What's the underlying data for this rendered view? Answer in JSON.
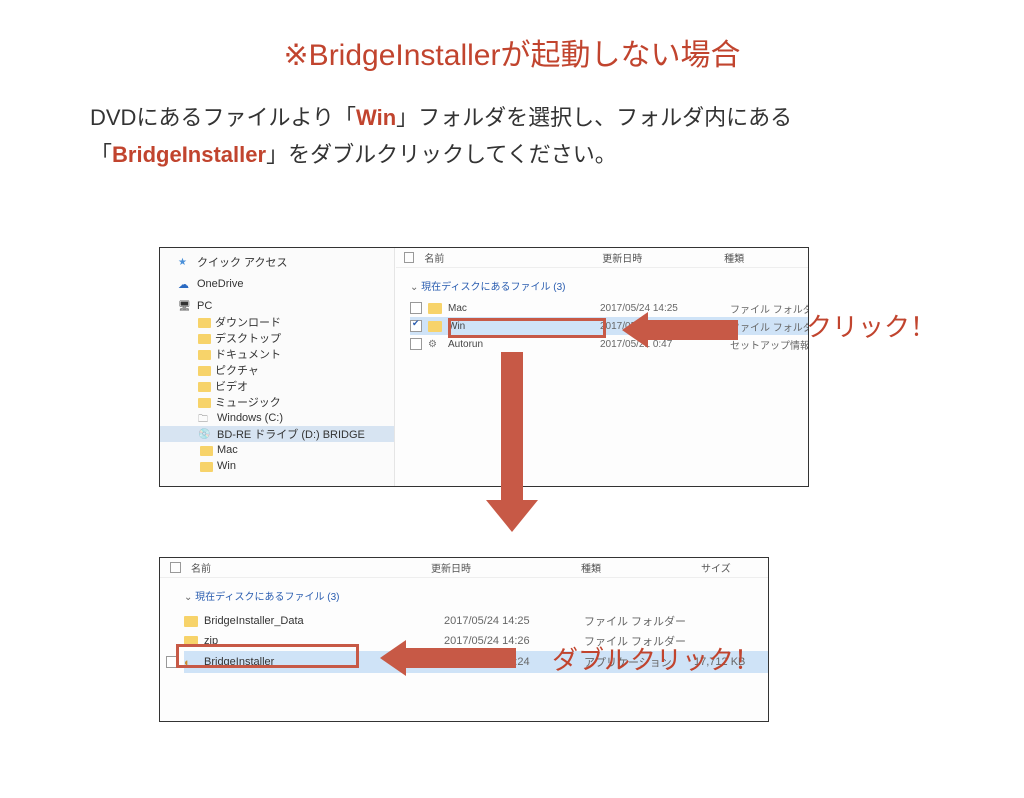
{
  "title": "※BridgeInstallerが起動しない場合",
  "desc": {
    "pre1": "DVDにあるファイルより「",
    "em1": "Win",
    "mid1": "」フォルダを選択し、フォルダ内にある「",
    "em2": "BridgeInstaller",
    "post1": "」をダブルクリックしてください。"
  },
  "panel1": {
    "sidebar": {
      "items": [
        {
          "label": "クイック アクセス",
          "icon": "star"
        },
        {
          "label": "OneDrive",
          "icon": "cloud"
        },
        {
          "label": "PC",
          "icon": "pc"
        },
        {
          "label": "ダウンロード",
          "icon": "folder",
          "sub": true
        },
        {
          "label": "デスクトップ",
          "icon": "folder",
          "sub": true
        },
        {
          "label": "ドキュメント",
          "icon": "folder",
          "sub": true
        },
        {
          "label": "ピクチャ",
          "icon": "folder",
          "sub": true
        },
        {
          "label": "ビデオ",
          "icon": "folder",
          "sub": true
        },
        {
          "label": "ミュージック",
          "icon": "folder",
          "sub": true
        },
        {
          "label": "Windows (C:)",
          "icon": "drive",
          "sub": true
        },
        {
          "label": "BD-RE ドライブ (D:) BRIDGE",
          "icon": "disk",
          "sub": true,
          "selected": true
        },
        {
          "label": "Mac",
          "icon": "folder",
          "sub2": true
        },
        {
          "label": "Win",
          "icon": "folder",
          "sub2": true
        }
      ]
    },
    "header": {
      "name": "名前",
      "date": "更新日時",
      "type": "種類"
    },
    "group_label": "現在ディスクにあるファイル (3)",
    "rows": [
      {
        "name": "Mac",
        "date": "2017/05/24 14:25",
        "type": "ファイル フォルダー",
        "icon": "folder",
        "checked": false,
        "selected": false
      },
      {
        "name": "Win",
        "date": "2017/05/24 14:26",
        "type": "ファイル フォルダー",
        "icon": "folder",
        "checked": true,
        "selected": true
      },
      {
        "name": "Autorun",
        "date": "2017/05/21 0:47",
        "type": "セットアップ情報",
        "icon": "setup",
        "checked": false,
        "selected": false
      }
    ]
  },
  "panel2": {
    "header": {
      "name": "名前",
      "date": "更新日時",
      "type": "種類",
      "size": "サイズ"
    },
    "group_label": "現在ディスクにあるファイル (3)",
    "rows": [
      {
        "name": "BridgeInstaller_Data",
        "date": "2017/05/24 14:25",
        "type": "ファイル フォルダー",
        "size": "",
        "icon": "folder",
        "selected": false
      },
      {
        "name": "zip",
        "date": "2017/05/24 14:26",
        "type": "ファイル フォルダー",
        "size": "",
        "icon": "folder",
        "selected": false
      },
      {
        "name": "BridgeInstaller",
        "date": "2017/05/24 14:24",
        "type": "アプリケーション",
        "size": "17,712 KB",
        "icon": "app",
        "selected": true
      }
    ]
  },
  "callouts": {
    "click": "クリック！",
    "dblclick": "ダブルクリック！"
  }
}
